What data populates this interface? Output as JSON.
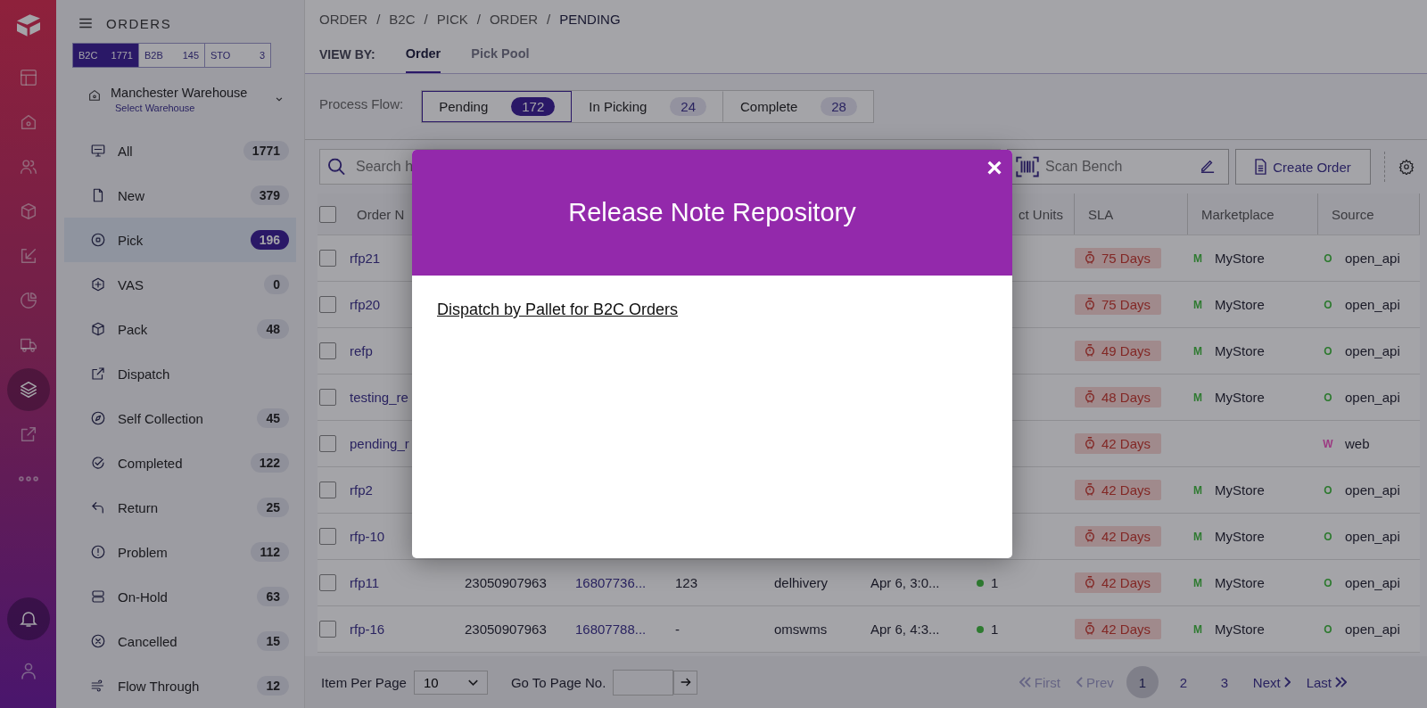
{
  "rail": {
    "items": [
      {
        "selected": false
      },
      {
        "selected": false
      },
      {
        "selected": false
      },
      {
        "selected": false
      },
      {
        "selected": false
      },
      {
        "selected": false
      },
      {
        "selected": false
      },
      {
        "selected": true
      },
      {
        "selected": false
      },
      {
        "selected": false
      }
    ]
  },
  "sidebar": {
    "title": "ORDERS",
    "channels": [
      {
        "label": "B2C",
        "count": "1771",
        "selected": true
      },
      {
        "label": "B2B",
        "count": "145",
        "selected": false
      },
      {
        "label": "STO",
        "count": "3",
        "selected": false
      }
    ],
    "warehouse": {
      "name": "Manchester Warehouse",
      "link": "Select Warehouse"
    },
    "items": [
      {
        "label": "All",
        "count": "1771",
        "selected": false
      },
      {
        "label": "New",
        "count": "379",
        "selected": false
      },
      {
        "label": "Pick",
        "count": "196",
        "selected": true
      },
      {
        "label": "VAS",
        "count": "0",
        "selected": false
      },
      {
        "label": "Pack",
        "count": "48",
        "selected": false
      },
      {
        "label": "Dispatch",
        "selected": false
      },
      {
        "label": "Self Collection",
        "count": "45",
        "selected": false
      },
      {
        "label": "Completed",
        "count": "122",
        "selected": false
      },
      {
        "label": "Return",
        "count": "25",
        "selected": false
      },
      {
        "label": "Problem",
        "count": "112",
        "selected": false
      },
      {
        "label": "On-Hold",
        "count": "63",
        "selected": false
      },
      {
        "label": "Cancelled",
        "count": "15",
        "selected": false
      },
      {
        "label": "Flow Through",
        "count": "12",
        "selected": false
      }
    ]
  },
  "breadcrumb": [
    {
      "label": "ORDER"
    },
    {
      "separator": "/",
      "label": "B2C"
    },
    {
      "separator": "/",
      "label": "PICK"
    },
    {
      "separator": "/",
      "label": "ORDER"
    },
    {
      "separator": "/",
      "label": "PENDING"
    }
  ],
  "view_by": {
    "label": "VIEW BY:",
    "tabs": [
      {
        "label": "Order",
        "selected": true
      },
      {
        "label": "Pick Pool",
        "selected": false
      }
    ]
  },
  "process_flow": {
    "label": "Process Flow:",
    "steps": [
      {
        "label": "Pending",
        "count": "172",
        "selected": true
      },
      {
        "label": "In Picking",
        "count": "24",
        "selected": false
      },
      {
        "label": "Complete",
        "count": "28",
        "selected": false
      }
    ]
  },
  "toolbar": {
    "search": {
      "placeholder": "Search h"
    },
    "scan": {
      "placeholder": "Scan Bench"
    },
    "create_button": "Create Order"
  },
  "table": {
    "select_all": {
      "checked": false
    },
    "headers": {
      "order_no": "Order N",
      "units": "ct Units",
      "sla": "SLA",
      "marketplace": "Marketplace",
      "source": "Source"
    },
    "rows": [
      {
        "checked": false,
        "order_no": "rfp21",
        "sla": "75 Days",
        "marketplace": {
          "initial": "M",
          "name": "MyStore",
          "color": "#2e7a30"
        },
        "source": {
          "initial": "O",
          "name": "open_api",
          "color": "#2e7a30"
        }
      },
      {
        "checked": false,
        "order_no": "rfp20",
        "sla": "75 Days",
        "marketplace": {
          "initial": "M",
          "name": "MyStore",
          "color": "#2e7a30"
        },
        "source": {
          "initial": "O",
          "name": "open_api",
          "color": "#2e7a30"
        }
      },
      {
        "checked": false,
        "order_no": "refp",
        "sla": "49 Days",
        "marketplace": {
          "initial": "M",
          "name": "MyStore",
          "color": "#2e7a30"
        },
        "source": {
          "initial": "O",
          "name": "open_api",
          "color": "#2e7a30"
        }
      },
      {
        "checked": false,
        "order_no": "testing_re",
        "sla": "48 Days",
        "marketplace": {
          "initial": "M",
          "name": "MyStore",
          "color": "#2e7a30"
        },
        "source": {
          "initial": "O",
          "name": "open_api",
          "color": "#2e7a30"
        }
      },
      {
        "checked": false,
        "order_no": "pending_r",
        "sla": "42 Days",
        "source": {
          "initial": "W",
          "name": "web",
          "color": "#9c3a82"
        }
      },
      {
        "checked": false,
        "order_no": "rfp2",
        "sla": "42 Days",
        "marketplace": {
          "initial": "M",
          "name": "MyStore",
          "color": "#2e7a30"
        },
        "source": {
          "initial": "O",
          "name": "open_api",
          "color": "#2e7a30"
        }
      },
      {
        "checked": false,
        "order_no": "rfp-10",
        "sla": "42 Days",
        "marketplace": {
          "initial": "M",
          "name": "MyStore",
          "color": "#2e7a30"
        },
        "source": {
          "initial": "O",
          "name": "open_api",
          "color": "#2e7a30"
        }
      },
      {
        "checked": false,
        "order_no": "rfp11",
        "column_2": "23050907963",
        "column_3": "16807736...",
        "column_4": "123",
        "column_5": "delhivery",
        "column_6": "Apr 6, 3:0...",
        "units": {
          "value": "1",
          "color": "#2e7a30"
        },
        "sla": "42 Days",
        "marketplace": {
          "initial": "M",
          "name": "MyStore",
          "color": "#2e7a30"
        },
        "source": {
          "initial": "O",
          "name": "open_api",
          "color": "#2e7a30"
        }
      },
      {
        "checked": false,
        "order_no": "rfp-16",
        "column_2": "23050907963",
        "column_3": "16807788...",
        "column_4": "-",
        "column_5": "omswms",
        "column_6": "Apr 6, 4:3...",
        "units": {
          "value": "1",
          "color": "#2e7a30"
        },
        "sla": "42 Days",
        "marketplace": {
          "initial": "M",
          "name": "MyStore",
          "color": "#2e7a30"
        },
        "source": {
          "initial": "O",
          "name": "open_api",
          "color": "#2e7a30"
        }
      }
    ]
  },
  "footer": {
    "per_page_label": "Item Per Page",
    "per_page": "10",
    "goto_label": "Go To Page No.",
    "pagination": [
      {
        "kind": "first",
        "label": "First",
        "disabled": true
      },
      {
        "kind": "prev",
        "label": "Prev",
        "disabled": true
      },
      {
        "kind": "page",
        "label": "1",
        "selected": true
      },
      {
        "kind": "page",
        "label": "2",
        "selected": false
      },
      {
        "kind": "page",
        "label": "3",
        "selected": false
      },
      {
        "kind": "next",
        "label": "Next",
        "disabled": false
      },
      {
        "kind": "last",
        "label": "Last",
        "disabled": false
      }
    ]
  },
  "modal": {
    "title": "Release Note Repository",
    "close": "×",
    "links": [
      "Dispatch by Pallet for B2C Orders"
    ]
  }
}
